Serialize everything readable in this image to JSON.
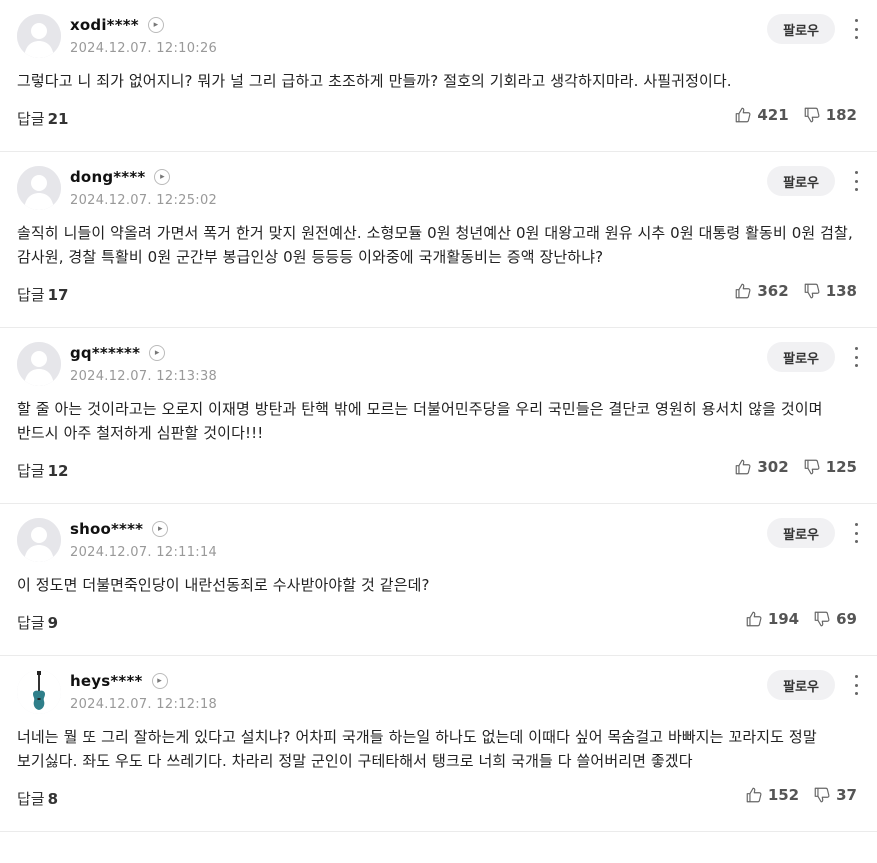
{
  "follow_label": "팔로우",
  "reply_label": "답글",
  "comments": [
    {
      "nick": "xodi****",
      "date": "2024.12.07. 12:10:26",
      "text": "그렇다고 니 죄가 없어지니? 뭐가 널 그리 급하고 초조하게 만들까? 절호의 기회라고 생각하지마라. 사필귀정이다.",
      "replies": "21",
      "likes": "421",
      "dislikes": "182",
      "avatar": "default"
    },
    {
      "nick": "dong****",
      "date": "2024.12.07. 12:25:02",
      "text": "솔직히 니들이 약올려 가면서 폭거 한거 맞지 원전예산. 소형모듈 0원 청년예산 0원 대왕고래 원유 시추 0원 대통령 활동비 0원 검찰, 감사원, 경찰 특활비 0원 군간부 봉급인상 0원 등등등 이와중에 국개활동비는 증액 장난하냐?",
      "replies": "17",
      "likes": "362",
      "dislikes": "138",
      "avatar": "default"
    },
    {
      "nick": "gq******",
      "date": "2024.12.07. 12:13:38",
      "text": "할 줄 아는 것이라고는 오로지 이재명 방탄과 탄핵 밖에 모르는 더불어민주당을 우리 국민들은 결단코 영원히 용서치 않을 것이며 반드시 아주 철저하게 심판할 것이다!!!",
      "replies": "12",
      "likes": "302",
      "dislikes": "125",
      "avatar": "default"
    },
    {
      "nick": "shoo****",
      "date": "2024.12.07. 12:11:14",
      "text": "이 정도면 더불면죽인당이 내란선동죄로 수사받아야할 것 같은데?",
      "replies": "9",
      "likes": "194",
      "dislikes": "69",
      "avatar": "default"
    },
    {
      "nick": "heys****",
      "date": "2024.12.07. 12:12:18",
      "text": "너네는 뭘 또 그리 잘하는게 있다고 설치냐? 어차피 국개들 하는일 하나도 없는데 이때다 싶어 목숨걸고 바빠지는 꼬라지도 정말 보기싫다. 좌도 우도 다 쓰레기다. 차라리 정말 군인이 구테타해서 탱크로 너희 국개들 다 쓸어버리면 좋겠다",
      "replies": "8",
      "likes": "152",
      "dislikes": "37",
      "avatar": "guitar"
    }
  ]
}
